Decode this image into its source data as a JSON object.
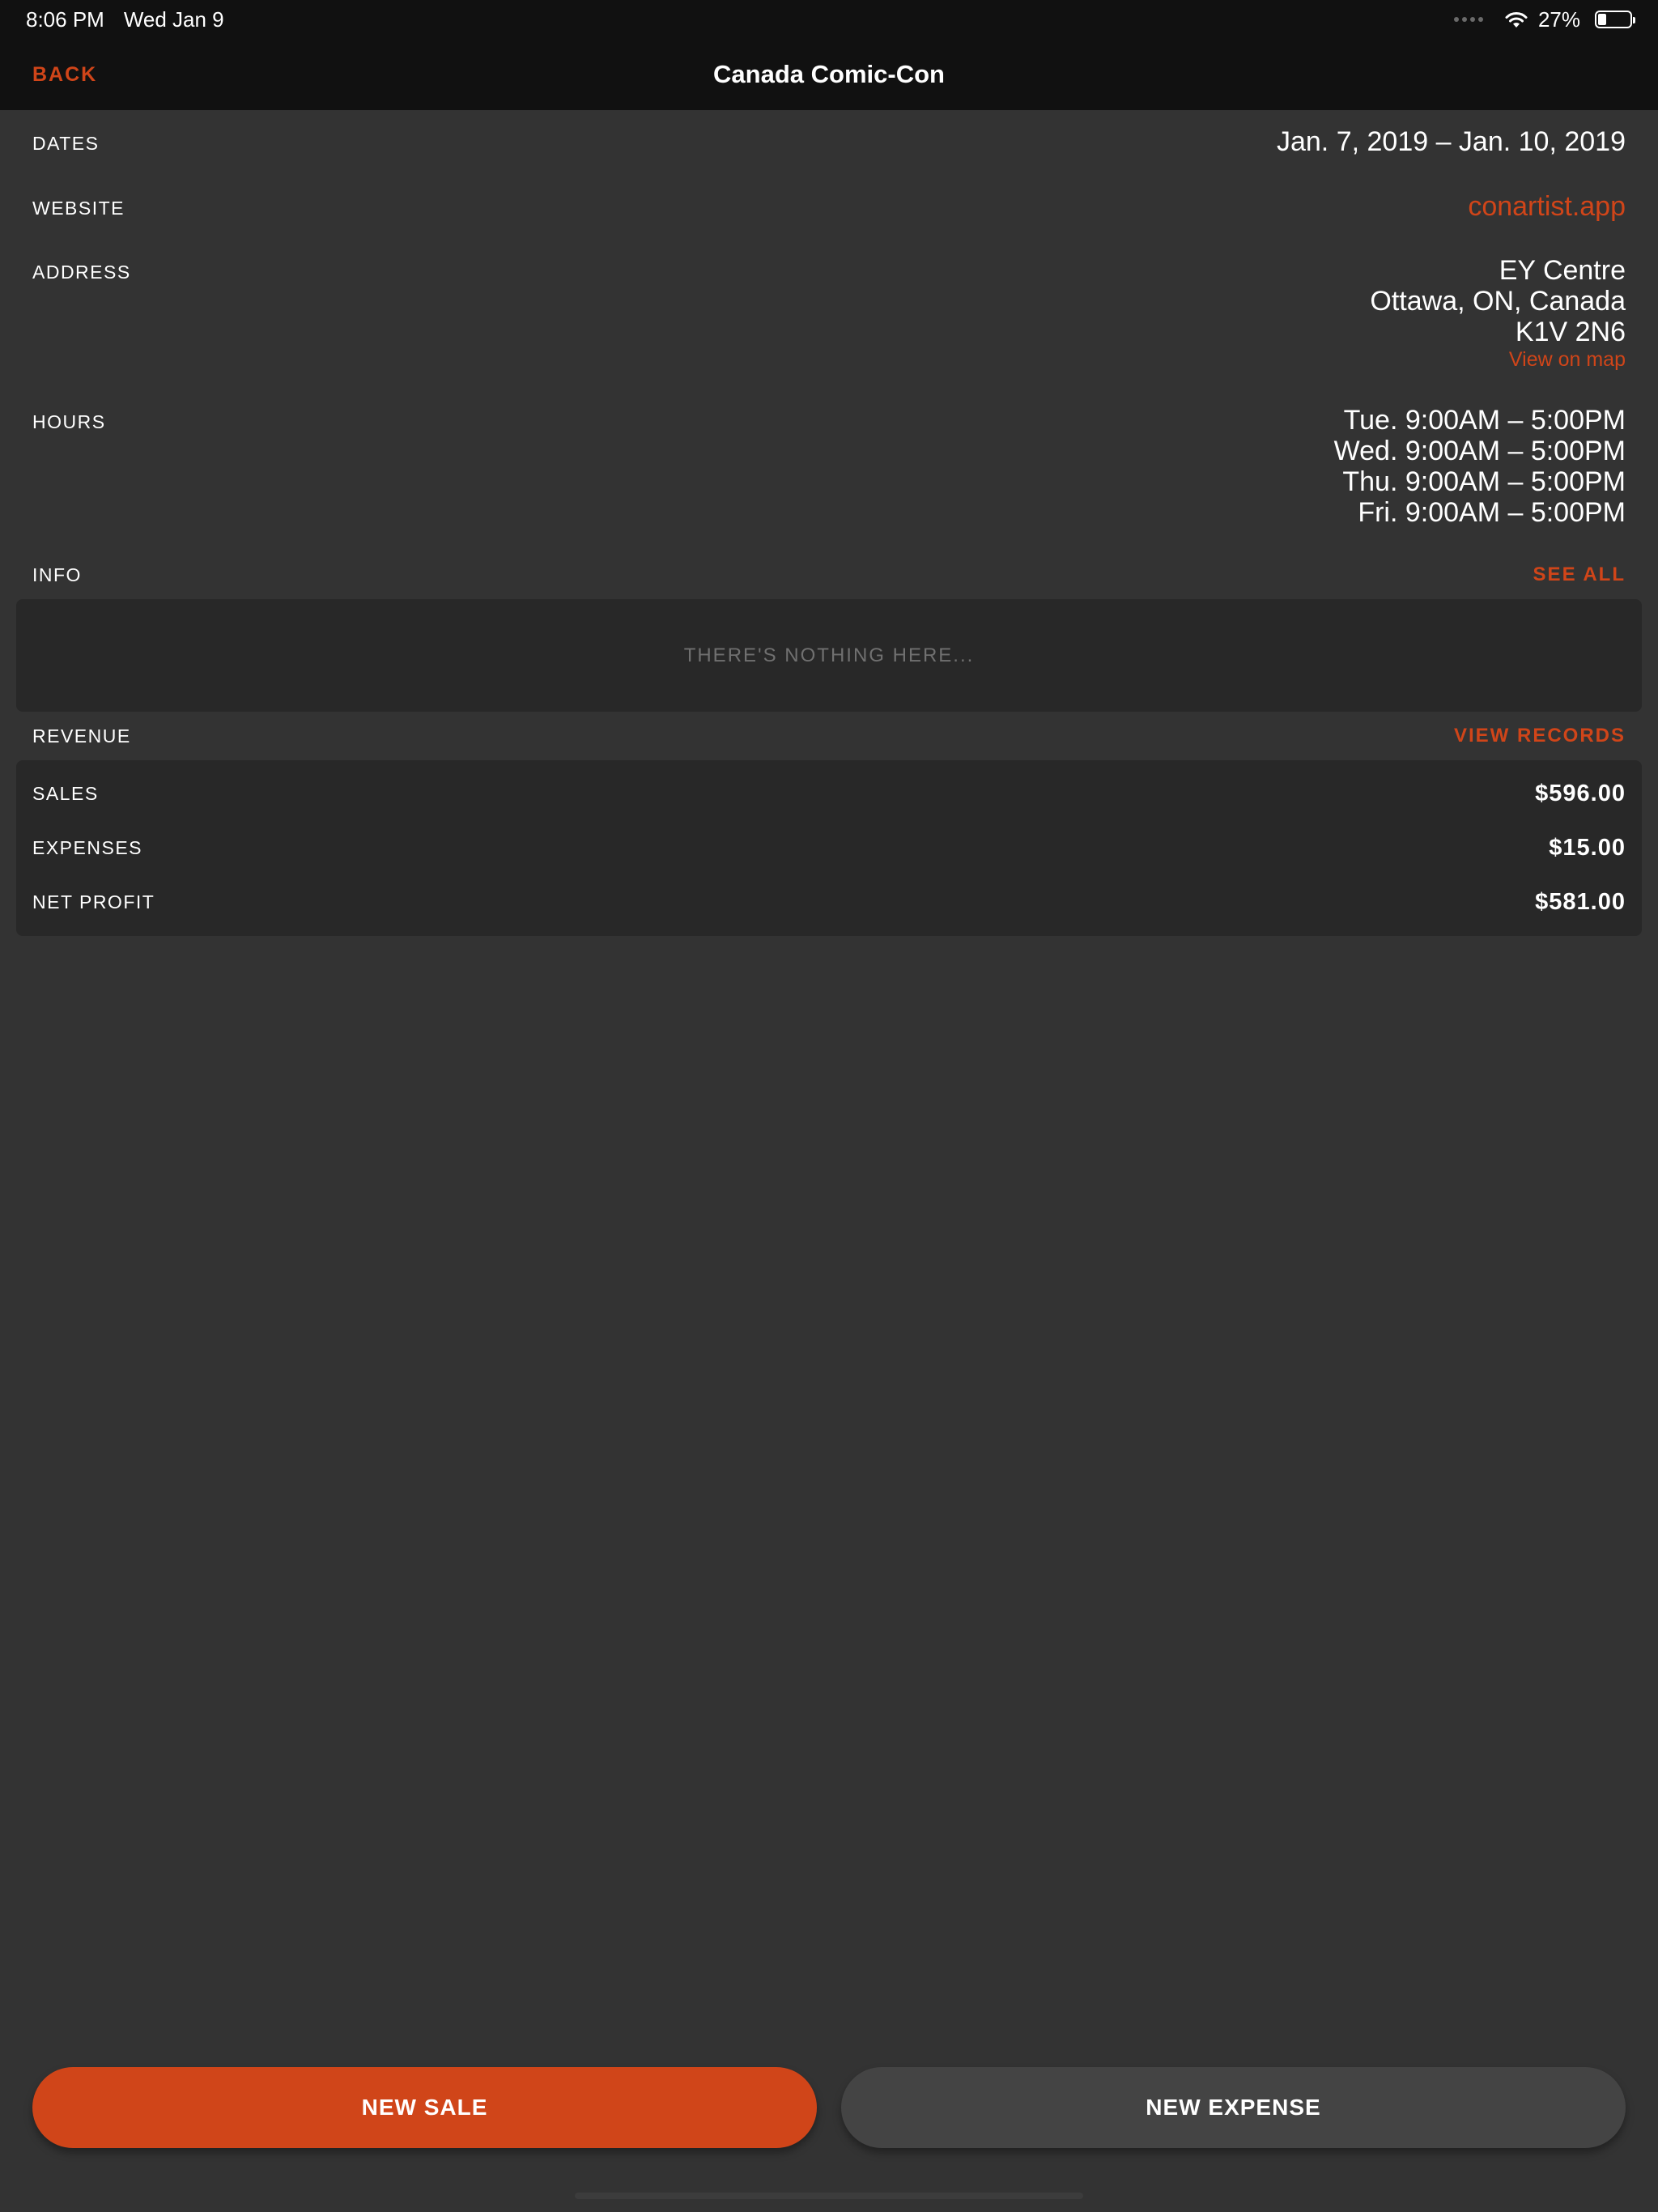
{
  "status_bar": {
    "time": "8:06 PM",
    "date": "Wed Jan 9",
    "battery_text": "27%",
    "battery_level": 0.27,
    "wifi_icon": "wifi-icon"
  },
  "nav": {
    "back_label": "BACK",
    "title": "Canada Comic-Con"
  },
  "details": {
    "dates": {
      "label": "DATES",
      "value": "Jan. 7, 2019 – Jan. 10, 2019"
    },
    "website": {
      "label": "WEBSITE",
      "value": "conartist.app"
    },
    "address": {
      "label": "ADDRESS",
      "lines": [
        "EY Centre",
        "Ottawa, ON, Canada",
        "K1V 2N6"
      ],
      "map_link": "View on map"
    },
    "hours": {
      "label": "HOURS",
      "lines": [
        "Tue. 9:00AM – 5:00PM",
        "Wed. 9:00AM – 5:00PM",
        "Thu. 9:00AM – 5:00PM",
        "Fri. 9:00AM – 5:00PM"
      ]
    }
  },
  "info": {
    "title": "INFO",
    "action": "SEE ALL",
    "empty_text": "THERE'S NOTHING HERE..."
  },
  "revenue": {
    "title": "REVENUE",
    "action": "VIEW RECORDS",
    "rows": [
      {
        "label": "SALES",
        "value": "$596.00"
      },
      {
        "label": "EXPENSES",
        "value": "$15.00"
      },
      {
        "label": "NET PROFIT",
        "value": "$581.00"
      }
    ]
  },
  "actions": {
    "new_sale": "NEW SALE",
    "new_expense": "NEW EXPENSE"
  },
  "colors": {
    "accent": "#d04519",
    "background": "#333333",
    "bar": "#111111",
    "card": "#282828",
    "secondary_button": "#444444"
  }
}
